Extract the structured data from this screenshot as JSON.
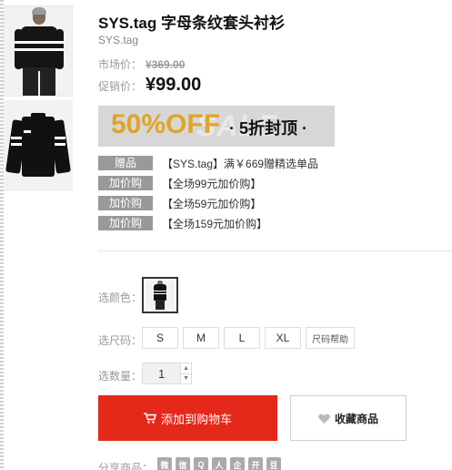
{
  "product": {
    "title": "SYS.tag 字母条纹套头衬衫",
    "brand": "SYS.tag"
  },
  "pricing": {
    "market_label": "市场价：",
    "market_price": "¥369.00",
    "promo_label": "促销价：",
    "promo_price": "¥99.00"
  },
  "banner": {
    "headline": "50%OFF",
    "subline": "· 5折封顶 ·",
    "ghost_text": "SALE"
  },
  "gifts": [
    {
      "tag": "赠品",
      "text": "【SYS.tag】满￥669赠精选单品"
    },
    {
      "tag": "加价购",
      "text": "【全场99元加价购】"
    },
    {
      "tag": "加价购",
      "text": "【全场59元加价购】"
    },
    {
      "tag": "加价购",
      "text": "【全场159元加价购】"
    }
  ],
  "options": {
    "color_label": "选颜色：",
    "size_label": "选尺码：",
    "sizes": [
      "S",
      "M",
      "L",
      "XL"
    ],
    "size_help": "尺码帮助",
    "qty_label": "选数量：",
    "qty_value": "1"
  },
  "actions": {
    "cart_label": "添加到购物车",
    "fav_label": "收藏商品"
  },
  "share": {
    "label": "分享商品：",
    "icons": [
      "weibo-icon",
      "wechat-icon",
      "qzone-icon",
      "renren-icon",
      "qq-icon",
      "kaixin-icon",
      "douban-icon"
    ]
  },
  "colors": {
    "accent_red": "#e4281a",
    "banner_orange": "#e2a32a"
  }
}
